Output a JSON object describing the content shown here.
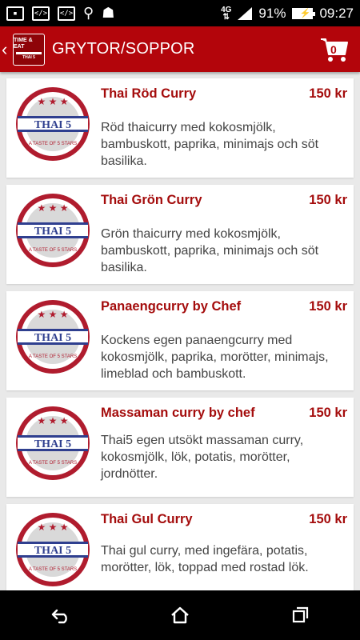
{
  "status_bar": {
    "network": "4G",
    "battery": "91%",
    "time": "09:27",
    "left_icons": [
      "image-icon",
      "code-icon",
      "code-icon",
      "usb-icon",
      "android-icon"
    ]
  },
  "app_bar": {
    "back_symbol": "‹",
    "logo_text_1": "TIME & EAT",
    "logo_text_2": "THAI 5",
    "title": "GRYTOR/SOPPOR",
    "cart_count": "0"
  },
  "items": [
    {
      "name": "Thai Röd Curry",
      "price": "150 kr",
      "description": "Röd thaicurry med kokosmjölk, bambuskott, paprika, minimajs och söt basilika."
    },
    {
      "name": "Thai Grön Curry",
      "price": "150 kr",
      "description": "Grön thaicurry med kokosmjölk, bambuskott, paprika, minimajs och söt basilika."
    },
    {
      "name": "Panaengcurry by Chef",
      "price": "150 kr",
      "description": "Kockens egen panaengcurry med kokosmjölk, paprika, morötter, minimajs, limeblad och bambuskott."
    },
    {
      "name": "Massaman curry by chef",
      "price": "150 kr",
      "description": "Thai5 egen utsökt massaman curry, kokosmjölk, lök, potatis, morötter, jordnötter."
    },
    {
      "name": "Thai Gul Curry",
      "price": "150 kr",
      "description": "Thai gul curry, med ingefära, potatis, morötter, lök, toppad med rostad lök."
    }
  ],
  "badge": {
    "main": "THAI 5",
    "ring": "A TASTE OF 5 STARS"
  },
  "colors": {
    "app_bar": "#b3050b",
    "accent": "#a40c0c"
  }
}
